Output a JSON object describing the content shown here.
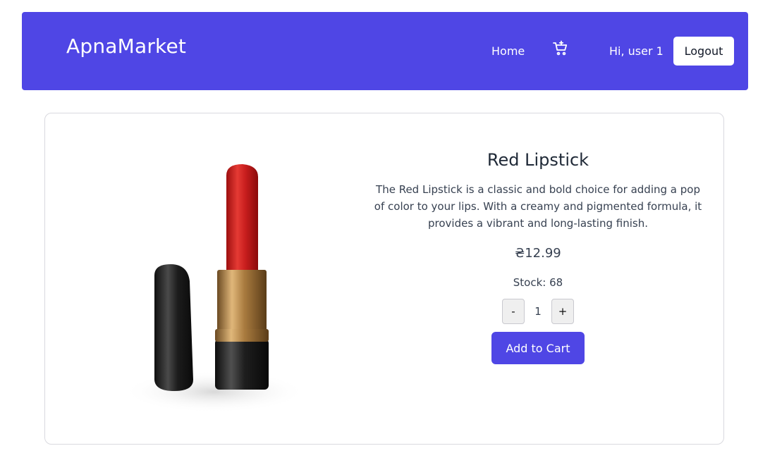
{
  "header": {
    "brand": "ApnaMarket",
    "home_label": "Home",
    "cart_icon": "cart-plus-icon",
    "greeting": "Hi, user 1",
    "logout_label": "Logout",
    "accent_color": "#4f46e5"
  },
  "product": {
    "title": "Red Lipstick",
    "description": "The Red Lipstick is a classic and bold choice for adding a pop of color to your lips. With a creamy and pigmented formula, it provides a vibrant and long-lasting finish.",
    "price": "₴12.99",
    "stock": "Stock: 68",
    "quantity": "1",
    "decrement_label": "-",
    "increment_label": "+",
    "add_to_cart_label": "Add to Cart"
  }
}
